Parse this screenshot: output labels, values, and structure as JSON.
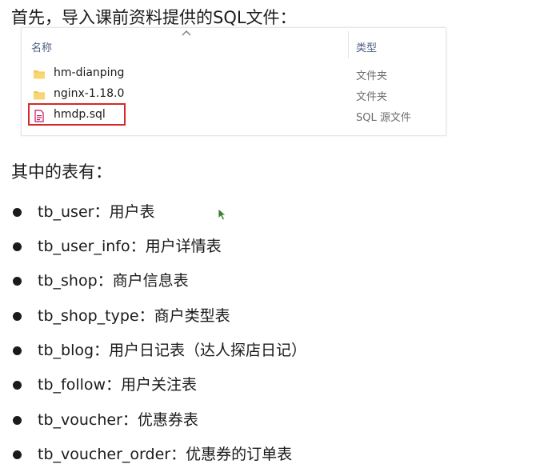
{
  "heading": "首先，导入课前资料提供的SQL文件：",
  "explorer": {
    "column_name": "名称",
    "column_type": "类型",
    "files": [
      {
        "name": "hm-dianping",
        "type": "文件夹",
        "icon": "folder-icon"
      },
      {
        "name": "nginx-1.18.0",
        "type": "文件夹",
        "icon": "folder-icon"
      },
      {
        "name": "hmdp.sql",
        "type": "SQL 源文件",
        "icon": "sql-file-icon"
      }
    ],
    "colors": {
      "folder": "#f2c94c",
      "highlight": "#d42a2a",
      "header_text": "#4d6082"
    }
  },
  "subheading": "其中的表有：",
  "tables": [
    "tb_user：用户表",
    "tb_user_info：用户详情表",
    "tb_shop：商户信息表",
    "tb_shop_type：商户类型表",
    "tb_blog：用户日记表（达人探店日记）",
    "tb_follow：用户关注表",
    "tb_voucher：优惠券表",
    "tb_voucher_order：优惠券的订单表"
  ]
}
